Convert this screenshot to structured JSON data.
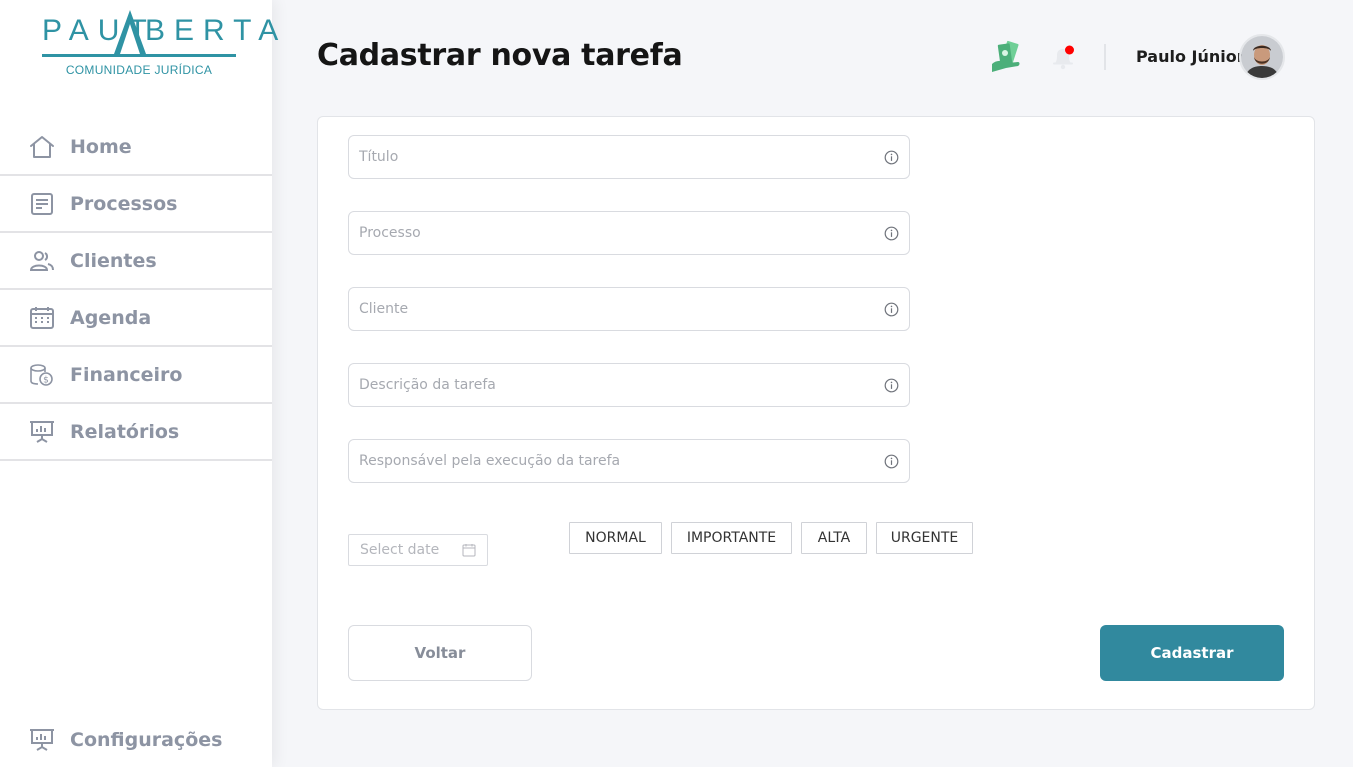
{
  "brand": {
    "logo_left": "PAUT",
    "logo_right": "BERTA",
    "logo_subtitle": "COMUNIDADE JURÍDICA",
    "color": "#2f93a4"
  },
  "sidebar": {
    "items": [
      {
        "label": "Home",
        "icon": "home-icon"
      },
      {
        "label": "Processos",
        "icon": "document-icon"
      },
      {
        "label": "Clientes",
        "icon": "users-icon"
      },
      {
        "label": "Agenda",
        "icon": "calendar-icon"
      },
      {
        "label": "Financeiro",
        "icon": "money-icon"
      },
      {
        "label": "Relatórios",
        "icon": "presentation-chart-icon"
      }
    ],
    "settings": {
      "label": "Configurações",
      "icon": "presentation-chart-icon"
    }
  },
  "header": {
    "title": "Cadastrar nova tarefa",
    "user_name": "Paulo Júnior",
    "notification_dot_color": "#ff0000"
  },
  "form": {
    "fields": [
      {
        "placeholder": "Título",
        "value": ""
      },
      {
        "placeholder": "Processo",
        "value": ""
      },
      {
        "placeholder": "Cliente",
        "value": ""
      },
      {
        "placeholder": "Descrição da tarefa",
        "value": ""
      },
      {
        "placeholder": "Responsável pela execução da tarefa",
        "value": ""
      }
    ],
    "date_placeholder": "Select date",
    "priorities": [
      "NORMAL",
      "IMPORTANTE",
      "ALTA",
      "URGENTE"
    ],
    "back_label": "Voltar",
    "submit_label": "Cadastrar",
    "accent_color": "#31899e"
  }
}
